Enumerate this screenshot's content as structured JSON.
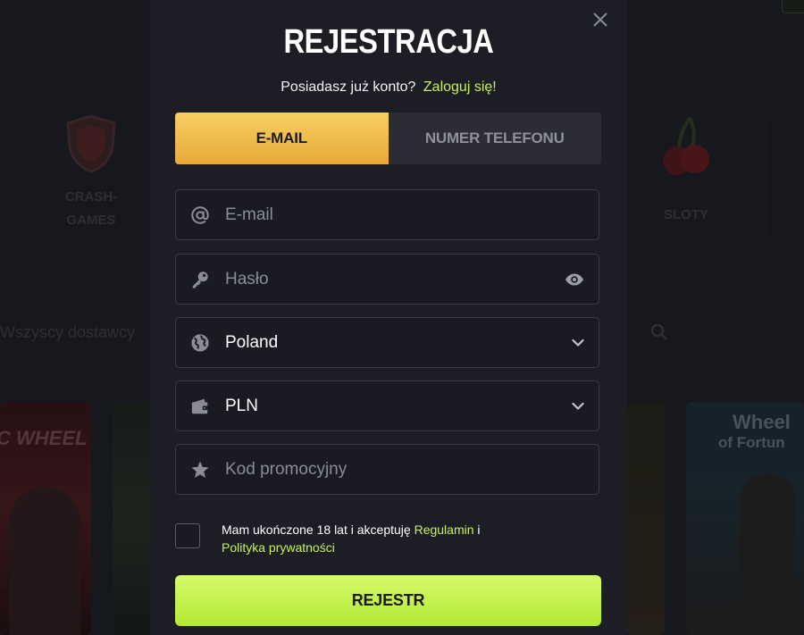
{
  "background": {
    "categories": [
      {
        "label_line1": "CRASH-",
        "label_line2": "GAMES",
        "icon": "shield-icon"
      },
      {
        "label_line1": "SLOTY",
        "icon": "cherry-icon"
      }
    ],
    "search_placeholder": "Wszyscy dostawcy",
    "tiles": [
      {
        "title": "C WHEEL"
      },
      {
        "title_line1": "Wheel",
        "title_line2": "of Fortun"
      }
    ]
  },
  "modal": {
    "title": "REJESTRACJA",
    "subtitle_text": "Posiadasz już konto?",
    "login_link": "Zaloguj się!",
    "tabs": [
      {
        "label": "E-MAIL",
        "active": true
      },
      {
        "label": "NUMER TELEFONU",
        "active": false
      }
    ],
    "fields": {
      "email": {
        "placeholder": "E-mail",
        "icon": "at-icon"
      },
      "password": {
        "placeholder": "Hasło",
        "icon": "key-icon",
        "toggle_icon": "eye-icon"
      },
      "country": {
        "value": "Poland",
        "icon": "globe-icon"
      },
      "currency": {
        "value": "PLN",
        "icon": "wallet-icon"
      },
      "promo": {
        "placeholder": "Kod promocyjny",
        "icon": "star-icon"
      }
    },
    "consent": {
      "text_before": "Mam ukończone 18 lat i akceptuję ",
      "terms_link": "Regulamin",
      "text_mid": " i",
      "privacy_link": "Polityka prywatności"
    },
    "submit_label": "REJESTR"
  },
  "colors": {
    "accent_green": "#c8f25a",
    "tab_active": "#f3bf4f",
    "modal_bg": "#1c1d25"
  }
}
